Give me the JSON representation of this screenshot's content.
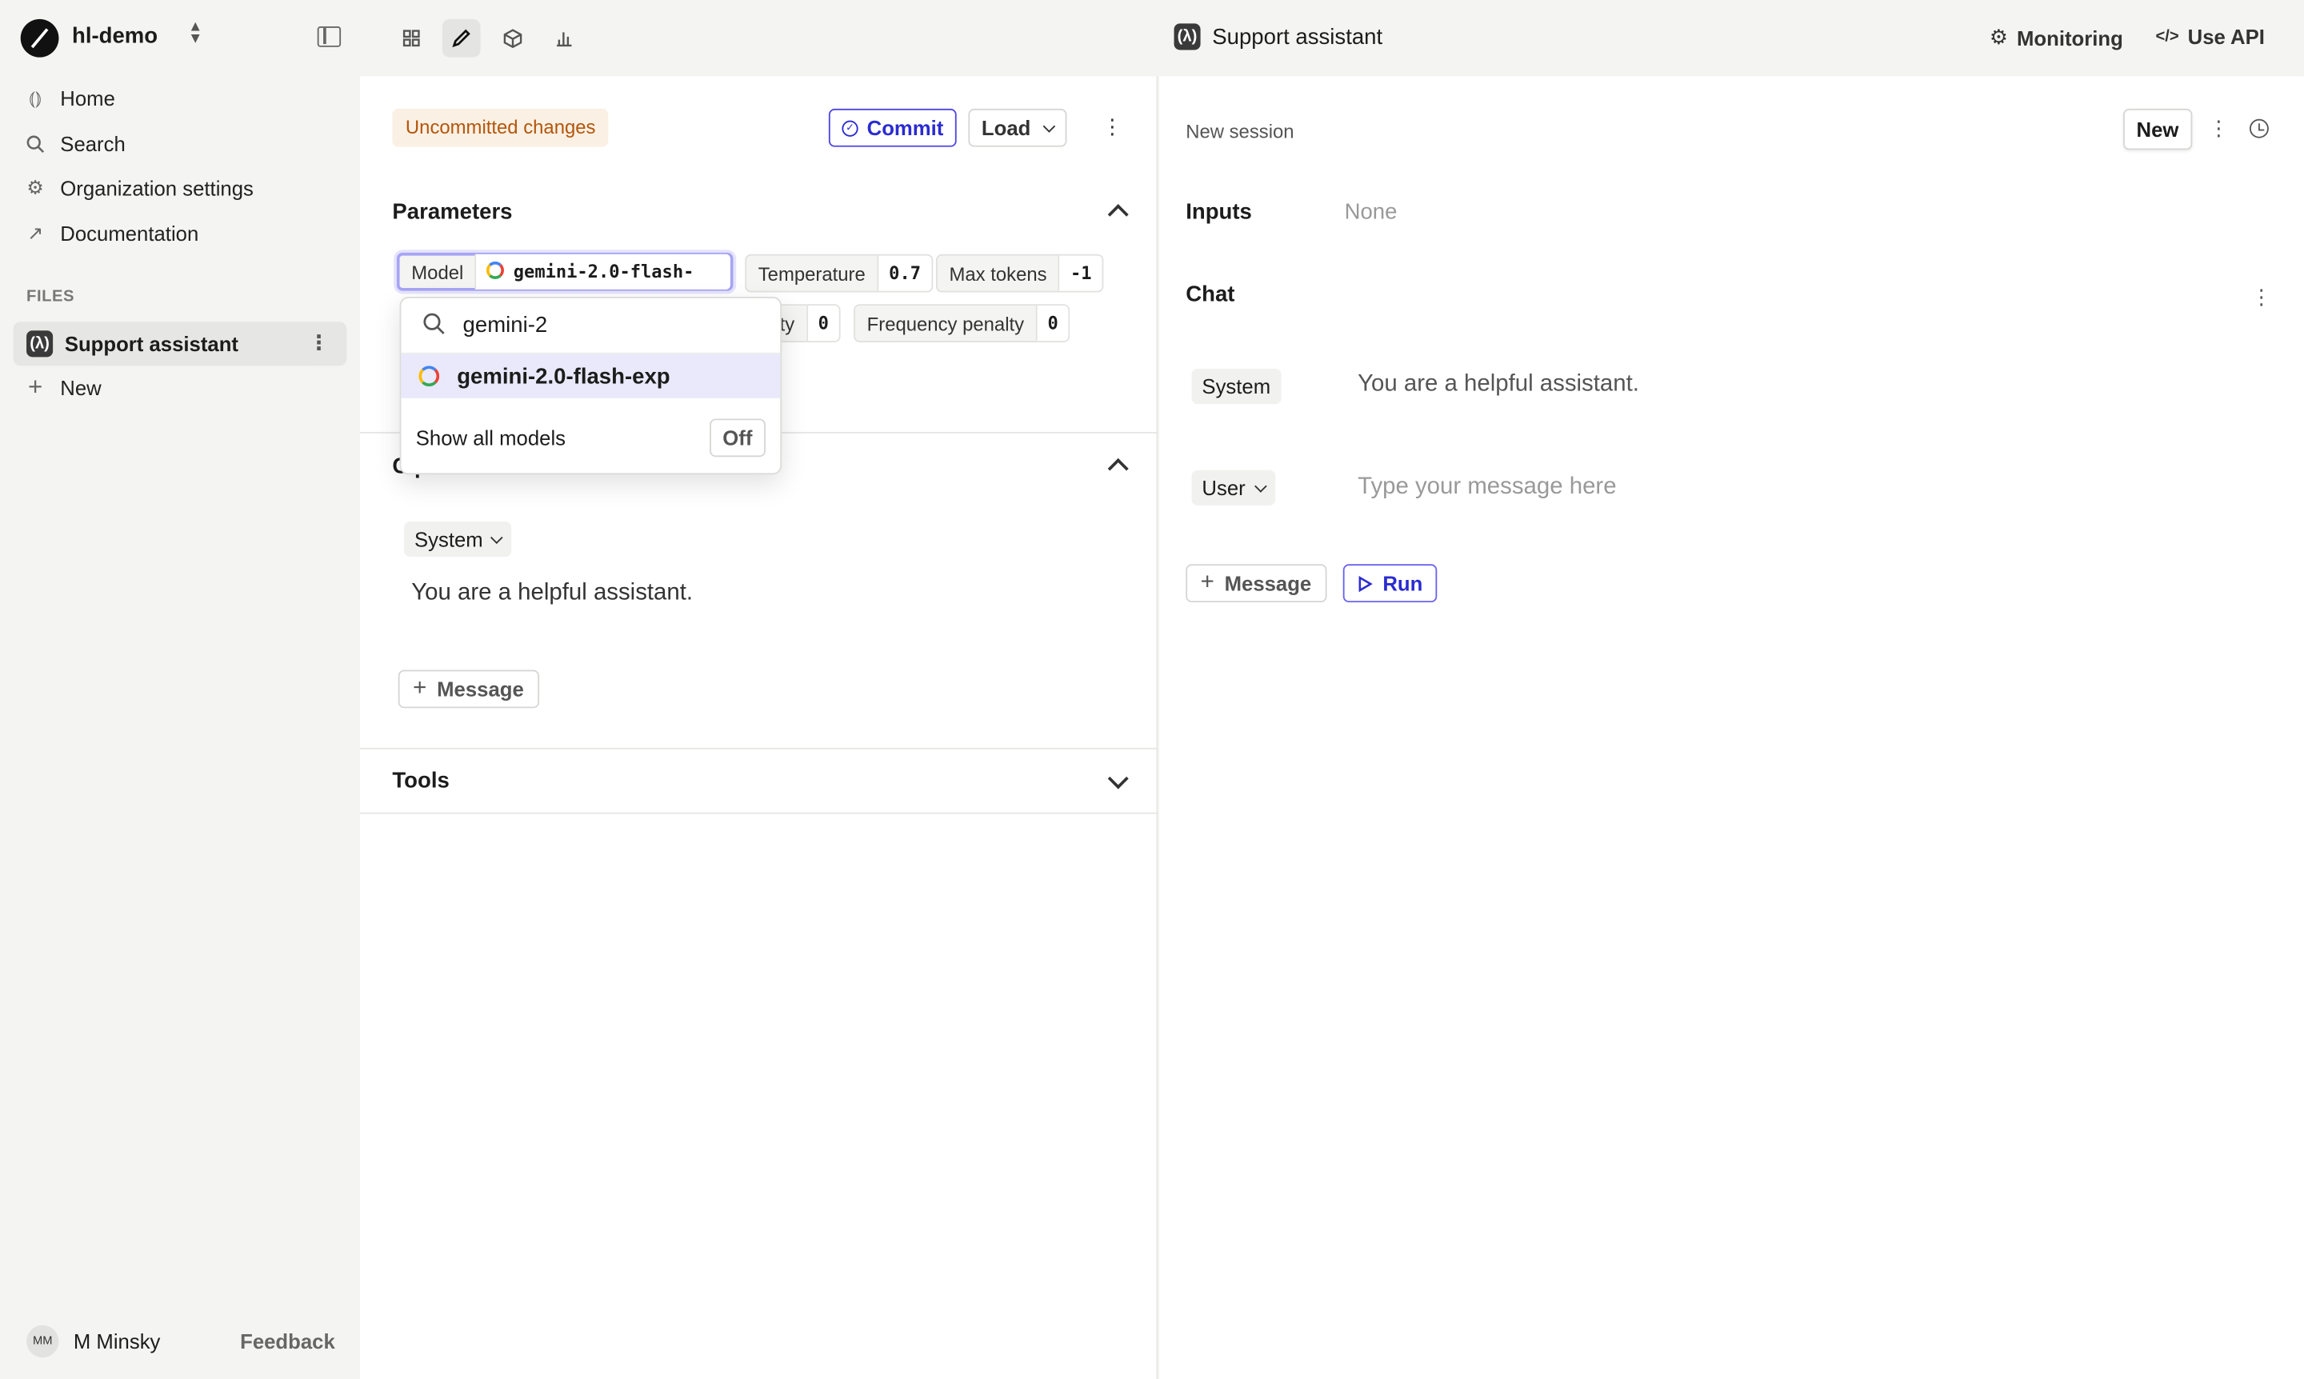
{
  "header": {
    "org_name": "hl-demo",
    "file_title": "Support assistant",
    "file_badge": "(λ)",
    "monitoring": "Monitoring",
    "use_api": "Use API"
  },
  "sidebar": {
    "nav": [
      {
        "label": "Home",
        "icon": "home-icon"
      },
      {
        "label": "Search",
        "icon": "search-icon"
      },
      {
        "label": "Organization settings",
        "icon": "gear-icon"
      },
      {
        "label": "Documentation",
        "icon": "arrow-up-right-icon"
      }
    ],
    "files_label": "FILES",
    "active_file": "Support assistant",
    "new_label": "New",
    "user_initials": "MM",
    "user_name": "M Minsky",
    "feedback": "Feedback"
  },
  "editor": {
    "status_badge": "Uncommitted changes",
    "commit_label": "Commit",
    "load_label": "Load",
    "parameters_title": "Parameters",
    "params": {
      "model_key": "Model",
      "model_value": "gemini-2.0-flash-exp",
      "temperature_key": "Temperature",
      "temperature_value": "0.7",
      "max_tokens_key": "Max tokens",
      "max_tokens_value": "-1",
      "presence_partial": "lty",
      "presence_value": "0",
      "frequency_key": "Frequency penalty",
      "frequency_value": "0"
    },
    "template_title_partial": "C          p",
    "system_role": "System",
    "system_message": "You are a helpful assistant.",
    "add_message_label": "Message",
    "tools_title": "Tools"
  },
  "model_dropdown": {
    "search_value": "gemini-2",
    "option": "gemini-2.0-flash-exp",
    "show_all_label": "Show all models",
    "show_all_state": "Off"
  },
  "session": {
    "label": "New session",
    "new_label": "New",
    "inputs_label": "Inputs",
    "inputs_value": "None",
    "chat_label": "Chat",
    "system_role": "System",
    "system_message": "You are a helpful assistant.",
    "user_role": "User",
    "user_placeholder": "Type your message here",
    "add_message_label": "Message",
    "run_label": "Run"
  },
  "colors": {
    "accent": "#2b2bd1",
    "warning_bg": "#fbf0e4",
    "warning_text": "#b4560a"
  }
}
